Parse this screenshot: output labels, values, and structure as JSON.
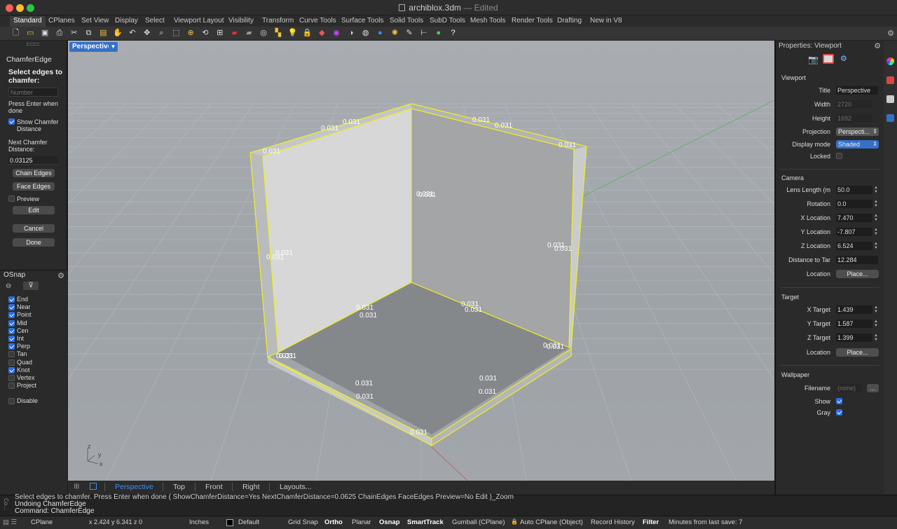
{
  "window": {
    "title": "archiblox.3dm",
    "separator": "—",
    "status": "Edited"
  },
  "tabs": [
    {
      "label": "Standard",
      "active": true
    },
    {
      "label": "CPlanes"
    },
    {
      "label": "Set View"
    },
    {
      "label": "Display"
    },
    {
      "label": "Select"
    },
    {
      "label": "Viewport Layout"
    },
    {
      "label": "Visibility"
    },
    {
      "label": "Transform"
    },
    {
      "label": "Curve Tools"
    },
    {
      "label": "Surface Tools"
    },
    {
      "label": "Solid Tools"
    },
    {
      "label": "SubD Tools"
    },
    {
      "label": "Mesh Tools"
    },
    {
      "label": "Render Tools"
    },
    {
      "label": "Drafting"
    },
    {
      "label": "New in V8"
    }
  ],
  "toolbar": [
    {
      "icon": "new-file-icon",
      "glyph": "🗋",
      "color": "#e8e8e8"
    },
    {
      "icon": "open-folder-icon",
      "glyph": "▭",
      "color": "#f0c040"
    },
    {
      "icon": "save-icon",
      "glyph": "▣",
      "color": "#ddd"
    },
    {
      "icon": "print-icon",
      "glyph": "⎙",
      "color": "#ddd"
    },
    {
      "icon": "cut-icon",
      "glyph": "✂",
      "color": "#ddd"
    },
    {
      "icon": "copy-icon",
      "glyph": "⧉",
      "color": "#ddd"
    },
    {
      "icon": "paste-icon",
      "glyph": "▤",
      "color": "#f0c040"
    },
    {
      "icon": "pan-hand-icon",
      "glyph": "✋",
      "color": "#ddd"
    },
    {
      "icon": "undo-icon",
      "glyph": "↶",
      "color": "#ddd"
    },
    {
      "icon": "move-icon",
      "glyph": "✥",
      "color": "#ddd"
    },
    {
      "icon": "zoom-icon",
      "glyph": "⌕",
      "color": "#ddd"
    },
    {
      "icon": "zoom-window-icon",
      "glyph": "⬚",
      "color": "#ddd"
    },
    {
      "icon": "zoom-selected-icon",
      "glyph": "⊕",
      "color": "#f0c040"
    },
    {
      "icon": "zoom-extents-icon",
      "glyph": "⟲",
      "color": "#ddd"
    },
    {
      "icon": "four-viewports-icon",
      "glyph": "⊞",
      "color": "#ddd"
    },
    {
      "icon": "car-render-icon",
      "glyph": "▰",
      "color": "#d33"
    },
    {
      "icon": "car-wire-icon",
      "glyph": "▰",
      "color": "#999"
    },
    {
      "icon": "select-icon",
      "glyph": "◎",
      "color": "#ddd"
    },
    {
      "icon": "points-icon",
      "glyph": "▚",
      "color": "#f0c040"
    },
    {
      "icon": "light-icon",
      "glyph": "💡",
      "color": "#ddd"
    },
    {
      "icon": "lock-icon",
      "glyph": "🔒",
      "color": "#ddd"
    },
    {
      "icon": "material-icon",
      "glyph": "◆",
      "color": "#e55"
    },
    {
      "icon": "color-wheel-icon",
      "glyph": "◉",
      "color": "#c4f"
    },
    {
      "icon": "render-sphere-icon",
      "glyph": "◑",
      "color": "#ddd"
    },
    {
      "icon": "grid-sphere-icon",
      "glyph": "◍",
      "color": "#ddd"
    },
    {
      "icon": "blue-sphere-icon",
      "glyph": "●",
      "color": "#3a8ef6"
    },
    {
      "icon": "sun-icon",
      "glyph": "✺",
      "color": "#f0c040"
    },
    {
      "icon": "paint-icon",
      "glyph": "✎",
      "color": "#ddd"
    },
    {
      "icon": "dimension-icon",
      "glyph": "⊢",
      "color": "#ddd"
    },
    {
      "icon": "globe-icon",
      "glyph": "●",
      "color": "#5c5"
    },
    {
      "icon": "help-icon",
      "glyph": "?",
      "color": "#fff"
    }
  ],
  "command": {
    "name": "ChamferEdge",
    "prompt": "Select edges to chamfer:",
    "number_placeholder": "Number",
    "press_enter": "Press Enter when done",
    "show_distance_label": "Show Chamfer Distance",
    "show_distance_checked": true,
    "next_distance_label": "Next Chamfer Distance:",
    "next_distance_value": "0.03125",
    "chain_edges": "Chain Edges",
    "face_edges": "Face Edges",
    "preview_label": "Preview",
    "preview_checked": false,
    "edit": "Edit",
    "cancel": "Cancel",
    "done": "Done"
  },
  "osnap": {
    "title": "OSnap",
    "items": [
      {
        "label": "End",
        "checked": true
      },
      {
        "label": "Near",
        "checked": true
      },
      {
        "label": "Point",
        "checked": true
      },
      {
        "label": "Mid",
        "checked": true
      },
      {
        "label": "Cen",
        "checked": true
      },
      {
        "label": "Int",
        "checked": true
      },
      {
        "label": "Perp",
        "checked": true
      },
      {
        "label": "Tan",
        "checked": false
      },
      {
        "label": "Quad",
        "checked": false
      },
      {
        "label": "Knot",
        "checked": true
      },
      {
        "label": "Vertex",
        "checked": false
      },
      {
        "label": "Project",
        "checked": false
      }
    ],
    "disable": {
      "label": "Disable",
      "checked": false
    }
  },
  "viewport": {
    "title": "Perspective",
    "dimension_labels": [
      "0.031",
      "0.031",
      "0.031",
      "0.031",
      "0.031",
      "0.031",
      "0.031",
      "0.031",
      "0.031",
      "0.031",
      "0.031",
      "0.031",
      "0.031",
      "0.031",
      "0.031",
      "0.031",
      "0.031",
      "0.031",
      "0.031",
      "0.031",
      "0.031",
      "0.031",
      "0.031",
      "0.031",
      "0.031"
    ],
    "axes": {
      "x": "x",
      "y": "y",
      "z": "z"
    },
    "colors": {
      "selection": "#f2f01a",
      "x_axis": "#c45050",
      "y_axis": "#58b058"
    }
  },
  "viewport_tabs": [
    "Perspective",
    "Top",
    "Front",
    "Right",
    "Layouts..."
  ],
  "properties": {
    "title": "Properties: Viewport",
    "sections": {
      "viewport": "Viewport",
      "camera": "Camera",
      "target": "Target",
      "wallpaper": "Wallpaper"
    },
    "viewport": {
      "title_label": "Title",
      "title_value": "Perspective",
      "width_label": "Width",
      "width_value": "2720",
      "height_label": "Height",
      "height_value": "1692",
      "projection_label": "Projection",
      "projection_value": "Perspecti...",
      "display_mode_label": "Display mode",
      "display_mode_value": "Shaded",
      "locked_label": "Locked",
      "locked_checked": false
    },
    "camera": {
      "lens_label": "Lens Length (m",
      "lens_value": "50.0",
      "rotation_label": "Rotation",
      "rotation_value": "0.0",
      "xloc_label": "X Location",
      "xloc_value": "7.470",
      "yloc_label": "Y Location",
      "yloc_value": "-7.807",
      "zloc_label": "Z Location",
      "zloc_value": "6.524",
      "dist_label": "Distance to Tar",
      "dist_value": "12.284",
      "location_label": "Location",
      "place_button": "Place..."
    },
    "target": {
      "x_label": "X Target",
      "x_value": "1.439",
      "y_label": "Y Target",
      "y_value": "1.587",
      "z_label": "Z Target",
      "z_value": "1.399",
      "location_label": "Location",
      "place_button": "Place..."
    },
    "wallpaper": {
      "filename_label": "Filename",
      "filename_value": "(none)",
      "browse": "...",
      "show_label": "Show",
      "show_checked": true,
      "gray_label": "Gray",
      "gray_checked": true
    }
  },
  "command_history": {
    "side": "Co...",
    "lines": [
      "Select edges to chamfer. Press Enter when done ( ShowChamferDistance=Yes NextChamferDistance=0.0625 ChainEdges FaceEdges Preview=No Edit )_Zoom",
      "Undoing ChamferEdge",
      "Command: ChamferEdge"
    ]
  },
  "status": {
    "cplane": "CPlane",
    "coords": "x 2.424  y 6.341  z 0",
    "units": "Inches",
    "layer": "Default",
    "grid_snap": "Grid Snap",
    "ortho": "Ortho",
    "planar": "Planar",
    "osnap": "Osnap",
    "smarttrack": "SmartTrack",
    "gumball": "Gumball (CPlane)",
    "auto_cplane": "Auto CPlane (Object)",
    "record_history": "Record History",
    "filter": "Filter",
    "last_save": "Minutes from last save: 7"
  }
}
